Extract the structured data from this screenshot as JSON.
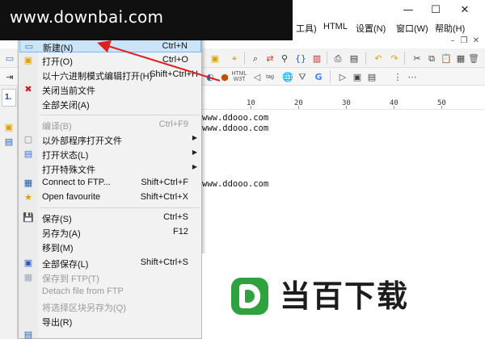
{
  "watermark": {
    "text": "www.downbai.com"
  },
  "window_controls": {
    "minimize": "—",
    "maximize": "☐",
    "close": "✕"
  },
  "menubar": [
    {
      "label": "工具)"
    },
    {
      "label": "HTML"
    },
    {
      "label": "设置(N)"
    },
    {
      "label": "窗口(W)"
    },
    {
      "label": "帮助(H)"
    }
  ],
  "mdi_controls": {
    "minimize": "–",
    "restore": "❐",
    "close": "✕"
  },
  "left_pane": {
    "tab_label": "1."
  },
  "toolbar2_labels": {
    "html_tag": "HTML",
    "html_sub": "W3T",
    "tag_text": "tag"
  },
  "ruler": [
    "10",
    "20",
    "30",
    "40",
    "50"
  ],
  "editor": {
    "lines": [
      "www.ddooo.com",
      "www.ddooo.com",
      "www.ddooo.com"
    ]
  },
  "menu": {
    "items": [
      {
        "label": "新建(N)",
        "shortcut": "Ctrl+N"
      },
      {
        "label": "打开(O)",
        "shortcut": "Ctrl+O"
      },
      {
        "label": "以十六进制模式编辑打开(H)",
        "shortcut": "Shift+Ctrl+H"
      },
      {
        "label": "关闭当前文件",
        "shortcut": ""
      },
      {
        "label": "全部关闭(A)",
        "shortcut": ""
      },
      {
        "label": "编译(B)",
        "shortcut": "Ctrl+F9"
      },
      {
        "label": "以外部程序打开文件",
        "shortcut": ""
      },
      {
        "label": "打开状态(L)",
        "shortcut": ""
      },
      {
        "label": "打开特殊文件",
        "shortcut": ""
      },
      {
        "label": "Connect to FTP...",
        "shortcut": "Shift+Ctrl+F"
      },
      {
        "label": "Open favourite",
        "shortcut": "Shift+Ctrl+X"
      },
      {
        "label": "保存(S)",
        "shortcut": "Ctrl+S"
      },
      {
        "label": "另存为(A)",
        "shortcut": "F12"
      },
      {
        "label": "移到(M)",
        "shortcut": ""
      },
      {
        "label": "全部保存(L)",
        "shortcut": "Shift+Ctrl+S"
      },
      {
        "label": "保存到 FTP(T)",
        "shortcut": ""
      },
      {
        "label": "Detach file from FTP",
        "shortcut": ""
      },
      {
        "label": "将选择区块另存为(Q)",
        "shortcut": ""
      },
      {
        "label": "导出(R)",
        "shortcut": ""
      }
    ]
  },
  "brand": {
    "name": "当百下载"
  },
  "colors": {
    "highlight": "#cce4f7",
    "highlight_border": "#7eb4ea",
    "annotation_arrow": "#e02020",
    "brand_green": "#2fa23f"
  }
}
